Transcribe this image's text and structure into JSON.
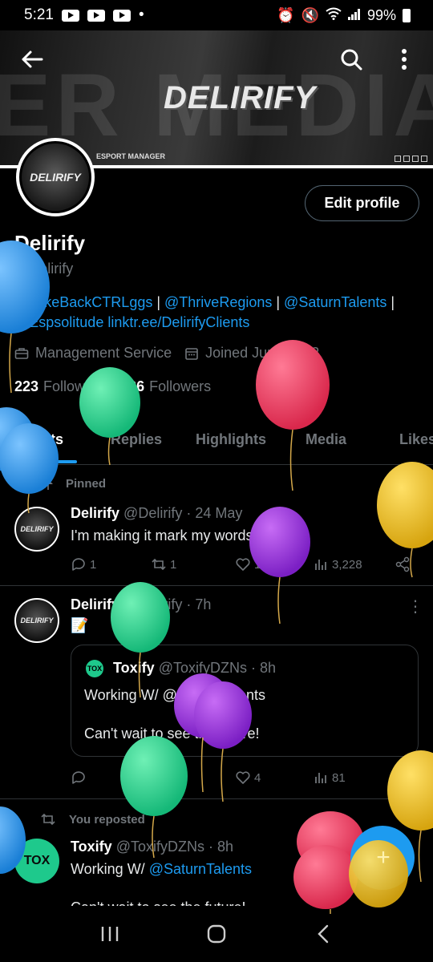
{
  "status": {
    "time": "5:21",
    "dot": "•",
    "battery": "99%"
  },
  "banner": {
    "logo_text": "DELIRIFY",
    "ghost_text": "ER MEDIA SOC",
    "esport_label": "ESPORT MANAGER"
  },
  "profile": {
    "avatar_text": "DELIRIFY",
    "edit_label": "Edit profile",
    "name": "Delirify",
    "handle": "@Delirify",
    "bio_links": [
      "@TakeBackCTRLggs",
      "@ThriveRegions",
      "@SaturnTalents",
      "@Espsolitude",
      "linktr.ee/DelirifyClients"
    ],
    "bio_sep": " | ",
    "category": "Management Service",
    "joined": "Joined June 2022",
    "following_count": "223",
    "following_label": "Following",
    "followers_count": "226",
    "followers_label": "Followers"
  },
  "tabs": [
    "Posts",
    "Replies",
    "Highlights",
    "Media",
    "Likes"
  ],
  "pinned_label": "Pinned",
  "tweets": [
    {
      "name": "Delirify",
      "handle": "@Delirify",
      "time": "· 24 May",
      "text": "I'm making it mark my words",
      "replies": "1",
      "reposts": "1",
      "likes": "11",
      "views": "3,228"
    },
    {
      "name": "Delirify",
      "handle": "@Delirify",
      "time": "· 7h",
      "text": "📝",
      "quote": {
        "avatar_text": "TOX",
        "name": "Toxify",
        "handle": "@ToxifyDZNs",
        "time": "· 8h",
        "line1": "Working W/ @SaturnTalents",
        "line2": "Can't wait to see the future!"
      },
      "replies": "",
      "reposts": "",
      "likes": "4",
      "views": "81"
    },
    {
      "repost_label": "You reposted",
      "name": "Toxify",
      "handle": "@ToxifyDZNs",
      "time": "· 8h",
      "text_prefix": "Working W/ ",
      "text_link": "@SaturnTalents",
      "text2": "Can't wait to see the future!",
      "avatar_text": "TOX"
    }
  ],
  "colors": {
    "accent": "#1d9bf0",
    "muted": "#71767b",
    "toxify": "#1ec98c"
  },
  "icons": [
    "back-arrow-icon",
    "search-icon",
    "more-vertical-icon",
    "briefcase-icon",
    "calendar-icon",
    "pin-icon",
    "reply-icon",
    "repost-icon",
    "like-icon",
    "views-icon",
    "share-icon",
    "compose-icon"
  ],
  "fab_label": "+"
}
